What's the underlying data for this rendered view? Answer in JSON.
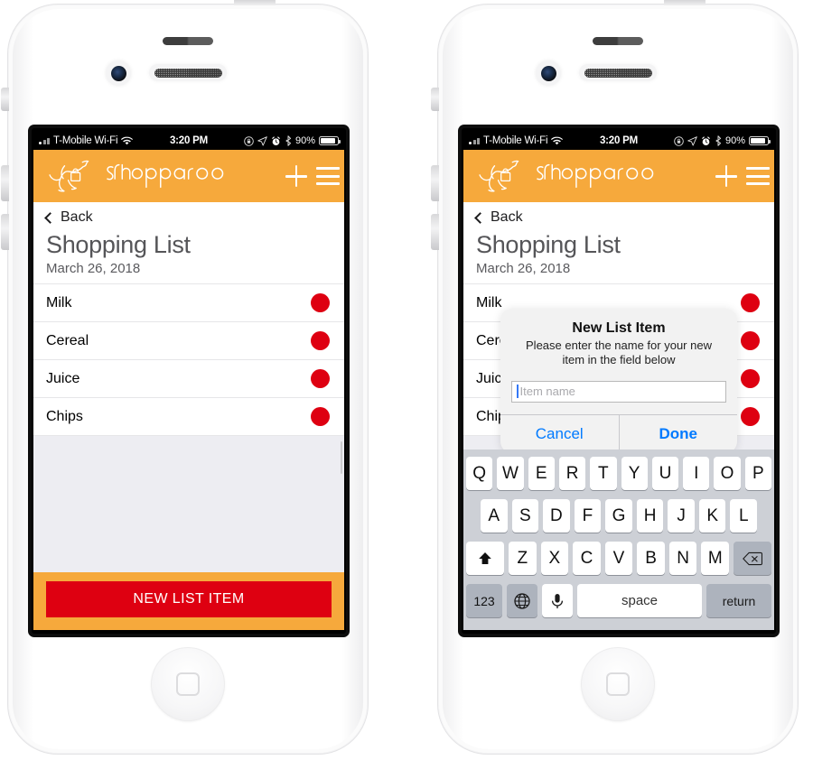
{
  "app": {
    "name": "shopparoo",
    "accent_orange": "#f6a93c",
    "accent_red": "#de0011",
    "ios_blue": "#007aff",
    "logo_icon": "kangaroo-shopping-logo",
    "plus_icon": "plus-icon",
    "menu_icon": "hamburger-menu-icon"
  },
  "status_bar": {
    "carrier": "T-Mobile Wi-Fi",
    "wifi_icon": "wifi-icon",
    "time": "3:20 PM",
    "rotation_lock_icon": "rotation-lock-icon",
    "location_icon": "location-arrow-icon",
    "alarm_icon": "alarm-clock-icon",
    "bluetooth_icon": "bluetooth-icon",
    "battery_percent": "90%",
    "battery_icon": "battery-icon"
  },
  "screen": {
    "back_label": "Back",
    "back_icon": "chevron-left-icon",
    "title": "Shopping List",
    "date": "March 26, 2018",
    "items": [
      {
        "name": "Milk",
        "status_icon": "red-status-dot"
      },
      {
        "name": "Cereal",
        "status_icon": "red-status-dot"
      },
      {
        "name": "Juice",
        "status_icon": "red-status-dot"
      },
      {
        "name": "Chips",
        "status_icon": "red-status-dot"
      }
    ],
    "cta_label": "NEW LIST ITEM"
  },
  "dialog": {
    "title": "New List Item",
    "message": "Please enter the name for your new item in the field below",
    "input_placeholder": "Item name",
    "input_value": "",
    "cancel_label": "Cancel",
    "done_label": "Done"
  },
  "keyboard": {
    "row1": [
      "Q",
      "W",
      "E",
      "R",
      "T",
      "Y",
      "U",
      "I",
      "O",
      "P"
    ],
    "row2": [
      "A",
      "S",
      "D",
      "F",
      "G",
      "H",
      "J",
      "K",
      "L"
    ],
    "row3": [
      "Z",
      "X",
      "C",
      "V",
      "B",
      "N",
      "M"
    ],
    "shift_icon": "shift-up-arrow-icon",
    "backspace_icon": "backspace-delete-icon",
    "numbers_label": "123",
    "globe_icon": "globe-language-icon",
    "mic_icon": "microphone-icon",
    "space_label": "space",
    "return_label": "return"
  }
}
